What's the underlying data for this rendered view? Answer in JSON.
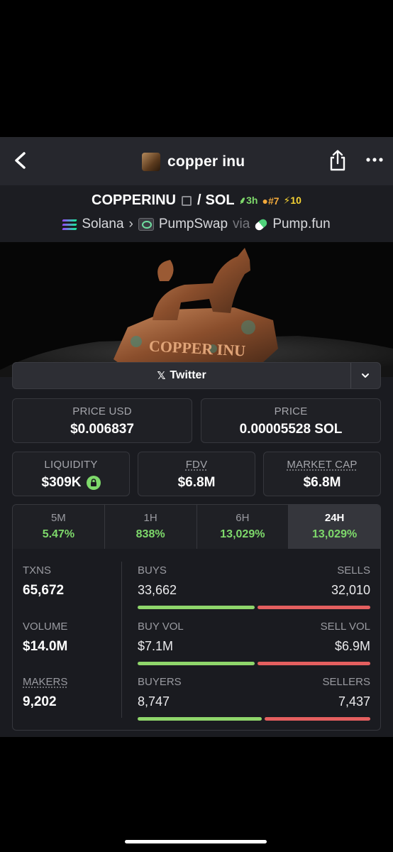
{
  "header": {
    "title": "copper inu"
  },
  "pair": {
    "base": "COPPERINU",
    "separator": "/",
    "quote": "SOL",
    "age": "3h",
    "rank": "#7",
    "boosts": "10",
    "chain": "Solana",
    "dex": "PumpSwap",
    "via_label": "via",
    "launchpad": "Pump.fun"
  },
  "banner": {
    "text": "COPPER INU"
  },
  "links": {
    "twitter_label": "Twitter"
  },
  "prices": {
    "usd_label": "PRICE USD",
    "usd_value": "$0.006837",
    "native_label": "PRICE",
    "native_value": "0.00005528 SOL"
  },
  "metrics": {
    "liquidity_label": "LIQUIDITY",
    "liquidity_value": "$309K",
    "fdv_label": "FDV",
    "fdv_value": "$6.8M",
    "mcap_label": "MARKET CAP",
    "mcap_value": "$6.8M"
  },
  "timeframes": [
    {
      "label": "5M",
      "change": "5.47%"
    },
    {
      "label": "1H",
      "change": "838%"
    },
    {
      "label": "6H",
      "change": "13,029%"
    },
    {
      "label": "24H",
      "change": "13,029%"
    }
  ],
  "active_timeframe": "24H",
  "stats": {
    "txns_label": "TXNS",
    "txns_value": "65,672",
    "volume_label": "VOLUME",
    "volume_value": "$14.0M",
    "makers_label": "MAKERS",
    "makers_value": "9,202",
    "buys_label": "BUYS",
    "buys_value": "33,662",
    "sells_label": "SELLS",
    "sells_value": "32,010",
    "buy_vol_label": "BUY VOL",
    "buy_vol_value": "$7.1M",
    "sell_vol_label": "SELL VOL",
    "sell_vol_value": "$6.9M",
    "buyers_label": "BUYERS",
    "buyers_value": "8,747",
    "sellers_label": "SELLERS",
    "sellers_value": "7,437"
  },
  "ratios": {
    "buys_fraction": 0.51,
    "buy_vol_fraction": 0.51,
    "buyers_fraction": 0.54
  },
  "colors": {
    "up": "#7ed96b",
    "buy_bar": "#8fd66b",
    "sell_bar": "#e45f5f",
    "rank": "#f2a93b",
    "boost": "#f5d233"
  }
}
